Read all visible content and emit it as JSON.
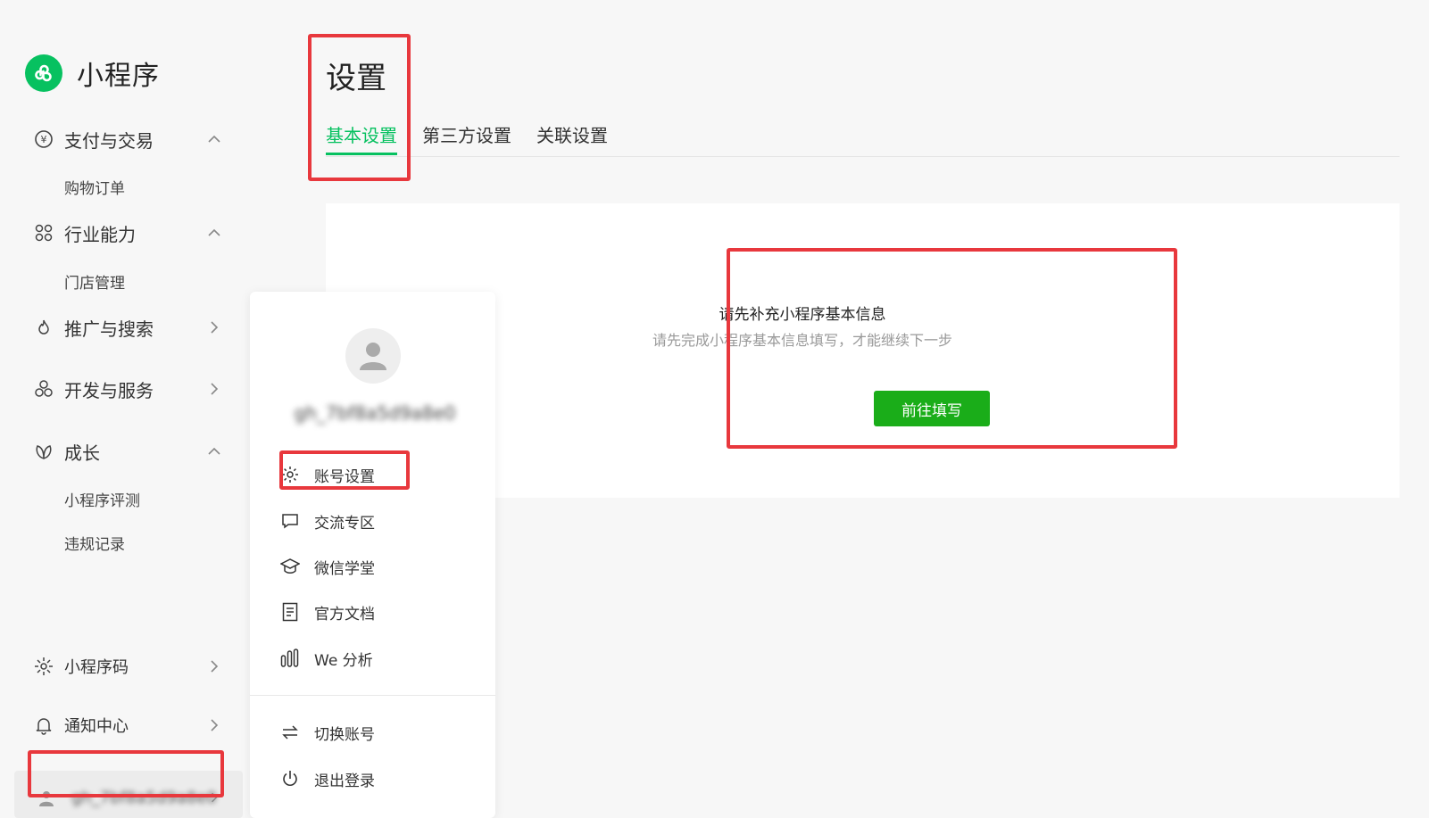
{
  "app": {
    "title": "小程序"
  },
  "sidebar": {
    "pay": {
      "label": "支付与交易",
      "sub": "购物订单"
    },
    "industry": {
      "label": "行业能力",
      "sub": "门店管理"
    },
    "promo": {
      "label": "推广与搜索"
    },
    "dev": {
      "label": "开发与服务"
    },
    "growth": {
      "label": "成长",
      "subs": [
        "小程序评测",
        "违规记录"
      ]
    },
    "qrcode": {
      "label": "小程序码"
    },
    "notify": {
      "label": "通知中心"
    },
    "account": {
      "name": "gh_7bf8a5d9a8e0"
    }
  },
  "main": {
    "title": "设置",
    "tabs": [
      "基本设置",
      "第三方设置",
      "关联设置"
    ],
    "notice": {
      "title": "请先补充小程序基本信息",
      "subtitle": "请先完成小程序基本信息填写，才能继续下一步",
      "button": "前往填写"
    }
  },
  "popup": {
    "username": "gh_7bf8a5d9a8e0",
    "items": [
      "账号设置",
      "交流专区",
      "微信学堂",
      "官方文档",
      "We 分析",
      "切换账号",
      "退出登录"
    ]
  },
  "colors": {
    "accent": "#07c160",
    "button": "#1aad19",
    "highlight": "#e8383d"
  }
}
